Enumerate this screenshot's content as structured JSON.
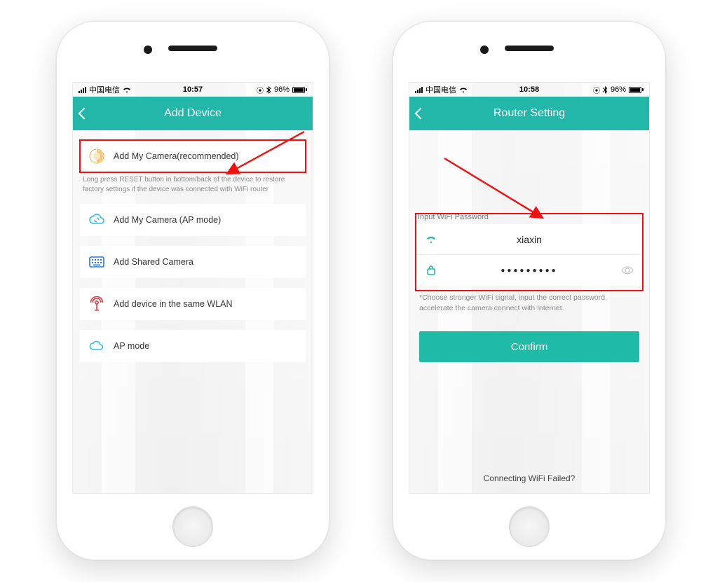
{
  "phone1": {
    "status": {
      "carrier": "中国电信",
      "time": "10:57",
      "battery": "96%"
    },
    "title": "Add Device",
    "items": [
      {
        "label": "Add My Camera(recommended)"
      },
      {
        "label": "Add My Camera (AP mode)"
      },
      {
        "label": "Add Shared Camera"
      },
      {
        "label": "Add device in the same WLAN"
      },
      {
        "label": "AP mode"
      }
    ],
    "reset_hint": "Long press RESET button in bottom/back of the device to restore factory settings if the device was connected with WiFi router"
  },
  "phone2": {
    "status": {
      "carrier": "中国电信",
      "time": "10:58",
      "battery": "96%"
    },
    "title": "Router Setting",
    "section_label": "Input WiFi Password",
    "ssid": "xiaxin",
    "password_mask": "●●●●●●●●●",
    "note": "*Choose stronger WiFi signal, input the correct password, accelerate the camera connect with Internet.",
    "confirm": "Confirm",
    "footer": "Connecting WiFi Failed?"
  },
  "glyphs": {
    "alarm": "⊛",
    "bluetooth": "✱"
  }
}
